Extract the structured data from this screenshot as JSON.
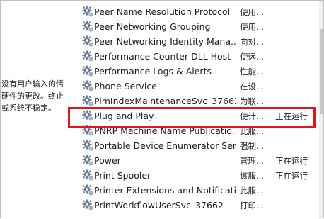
{
  "description_pane": {
    "lines": [
      "没有用户输入的情",
      "硬件的更改。终止",
      "或系统不稳定。"
    ]
  },
  "services": [
    {
      "name": "Peer Name Resolution Protocol",
      "description": "使用...",
      "status": ""
    },
    {
      "name": "Peer Networking Grouping",
      "description": "使用...",
      "status": ""
    },
    {
      "name": "Peer Networking Identity Mana...",
      "description": "向对...",
      "status": ""
    },
    {
      "name": "Performance Counter DLL Host",
      "description": "使远...",
      "status": ""
    },
    {
      "name": "Performance Logs & Alerts",
      "description": "性能...",
      "status": ""
    },
    {
      "name": "Phone Service",
      "description": "在设...",
      "status": ""
    },
    {
      "name": "PimIndexMaintenanceSvc_37662",
      "description": "为联...",
      "status": ""
    },
    {
      "name": "Plug and Play",
      "description": "使计...",
      "status": "正在运行"
    },
    {
      "name": "PNRP Machine Name Publicatio...",
      "description": "此服...",
      "status": ""
    },
    {
      "name": "Portable Device Enumerator Ser...",
      "description": "强制...",
      "status": ""
    },
    {
      "name": "Power",
      "description": "管理...",
      "status": "正在运行"
    },
    {
      "name": "Print Spooler",
      "description": "该服...",
      "status": "正在运行"
    },
    {
      "name": "Printer Extensions and Notificati...",
      "description": "此服...",
      "status": ""
    },
    {
      "name": "PrintWorkflowUserSvc_37662",
      "description": "打印...",
      "status": ""
    }
  ],
  "colors": {
    "highlight": "#e8141b",
    "icon_gear": "#6d7f93"
  },
  "icon": "gear-icon"
}
